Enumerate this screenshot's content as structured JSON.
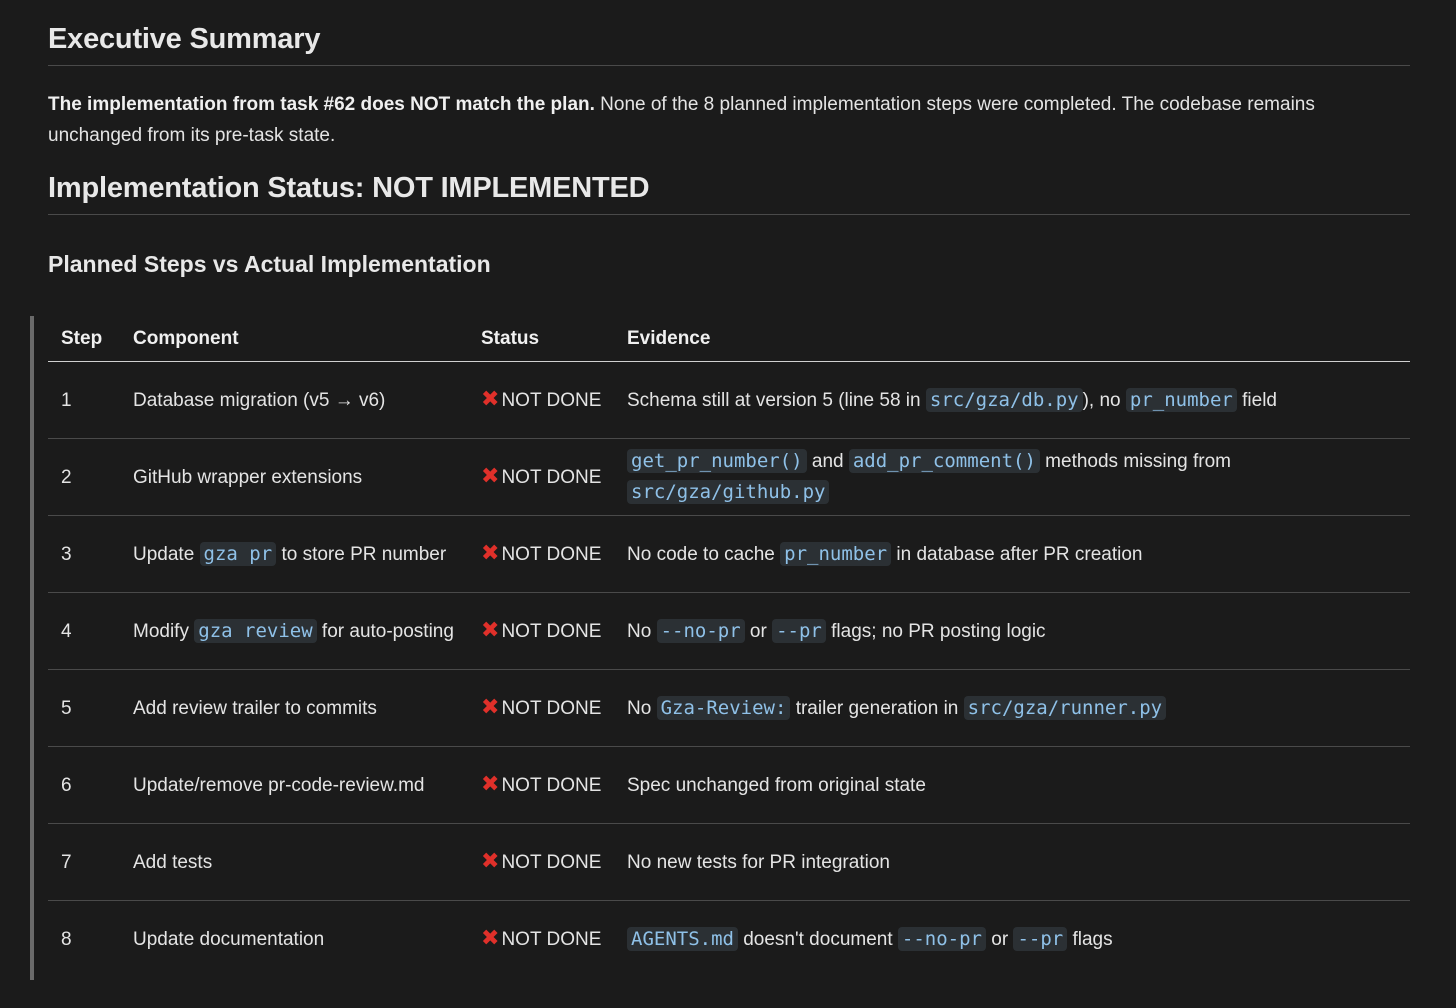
{
  "executive_summary": {
    "heading": "Executive Summary",
    "bold_text": "The implementation from task #62 does NOT match the plan.",
    "body_text": " None of the 8 planned implementation steps were completed. The codebase remains unchanged from its pre-task state."
  },
  "implementation_status": {
    "heading": "Implementation Status: NOT IMPLEMENTED"
  },
  "planned_steps": {
    "heading": "Planned Steps vs Actual Implementation",
    "columns": [
      "Step",
      "Component",
      "Status",
      "Evidence"
    ],
    "status_icon": "cross-mark-icon",
    "status_color": "#e0302a",
    "status_text": "NOT DONE",
    "rows": [
      {
        "step": "1",
        "component": [
          {
            "t": "Database migration (v5 → v6)"
          }
        ],
        "evidence": [
          {
            "t": "Schema still at version 5 (line 58 in "
          },
          {
            "c": "src/gza/db.py"
          },
          {
            "t": "), no "
          },
          {
            "c": "pr_number"
          },
          {
            "t": " field"
          }
        ]
      },
      {
        "step": "2",
        "component": [
          {
            "t": "GitHub wrapper extensions"
          }
        ],
        "evidence": [
          {
            "c": "get_pr_number()"
          },
          {
            "t": " and "
          },
          {
            "c": "add_pr_comment()"
          },
          {
            "t": " methods missing from "
          },
          {
            "c": "src/gza/github.py"
          }
        ]
      },
      {
        "step": "3",
        "component": [
          {
            "t": "Update "
          },
          {
            "c": "gza pr"
          },
          {
            "t": " to store PR number"
          }
        ],
        "evidence": [
          {
            "t": "No code to cache "
          },
          {
            "c": "pr_number"
          },
          {
            "t": " in database after PR creation"
          }
        ]
      },
      {
        "step": "4",
        "component": [
          {
            "t": "Modify "
          },
          {
            "c": "gza review"
          },
          {
            "t": " for auto-posting"
          }
        ],
        "evidence": [
          {
            "t": "No "
          },
          {
            "c": "--no-pr"
          },
          {
            "t": " or "
          },
          {
            "c": "--pr"
          },
          {
            "t": " flags; no PR posting logic"
          }
        ]
      },
      {
        "step": "5",
        "component": [
          {
            "t": "Add review trailer to commits"
          }
        ],
        "evidence": [
          {
            "t": "No "
          },
          {
            "c": "Gza-Review:"
          },
          {
            "t": " trailer generation in "
          },
          {
            "c": "src/gza/runner.py"
          }
        ]
      },
      {
        "step": "6",
        "component": [
          {
            "t": "Update/remove pr-code-review.md"
          }
        ],
        "evidence": [
          {
            "t": "Spec unchanged from original state"
          }
        ]
      },
      {
        "step": "7",
        "component": [
          {
            "t": "Add tests"
          }
        ],
        "evidence": [
          {
            "t": "No new tests for PR integration"
          }
        ]
      },
      {
        "step": "8",
        "component": [
          {
            "t": "Update documentation"
          }
        ],
        "evidence": [
          {
            "c": "AGENTS.md"
          },
          {
            "t": " doesn't document "
          },
          {
            "c": "--no-pr"
          },
          {
            "t": " or "
          },
          {
            "c": "--pr"
          },
          {
            "t": " flags"
          }
        ]
      }
    ]
  }
}
